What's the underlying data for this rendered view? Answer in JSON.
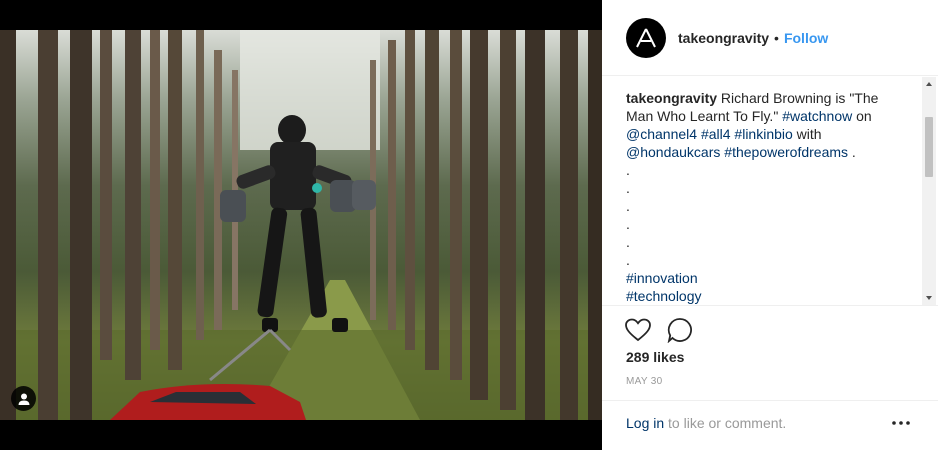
{
  "post": {
    "username": "takeongravity",
    "separator": "•",
    "follow_label": "Follow",
    "caption": {
      "username": "takeongravity",
      "text_1": " Richard Browning is \"The Man Who Learnt To Fly.\" ",
      "tag_watchnow": "#watchnow",
      "text_on": " on",
      "mention_channel4": "@channel4",
      "tag_all4": "#all4",
      "tag_linkinbio": "#linkinbio",
      "text_with": " with",
      "mention_hondaukcars": "@hondaukcars",
      "tag_thepowerofdreams": "#thepowerofdreams",
      "text_end": " .",
      "dots": [
        ".",
        ".",
        ".",
        ".",
        ".",
        "."
      ],
      "tag_innovation": "#innovation",
      "tag_technology": "#technology"
    },
    "likes": "289 likes",
    "date": "MAY 30",
    "login_link": "Log in",
    "login_rest": " to like or comment.",
    "more_label": "•••"
  },
  "icons": {
    "avatar": "triangle-logo-icon",
    "tag": "person-tag-icon",
    "like": "heart-icon",
    "comment": "comment-bubble-icon",
    "more": "more-options-icon",
    "scroll_up": "scroll-up-arrow-icon",
    "scroll_down": "scroll-down-arrow-icon"
  },
  "colors": {
    "link": "#003569",
    "follow": "#3897f0",
    "muted": "#999999",
    "border": "#efefef"
  }
}
